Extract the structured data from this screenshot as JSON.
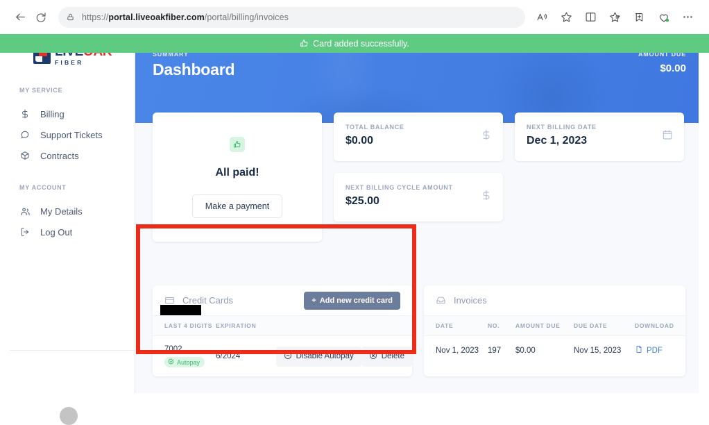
{
  "browser": {
    "url_bold": "portal.liveoakfiber.com",
    "url_rest": "/portal/billing/invoices",
    "url_scheme": "https://",
    "back_icon": "back-arrow-icon",
    "reload_icon": "reload-icon",
    "lock_icon": "lock-icon",
    "actions": [
      {
        "name": "read-aloud-icon",
        "label": "Read aloud"
      },
      {
        "name": "favorite-star-icon",
        "label": "Add to favorites"
      },
      {
        "name": "split-screen-icon",
        "label": "Split screen"
      },
      {
        "name": "collections-icon",
        "label": "Collections"
      },
      {
        "name": "add-to-collections-icon",
        "label": "Add to collections"
      },
      {
        "name": "browser-essentials-icon",
        "label": "Browser essentials"
      },
      {
        "name": "more-options-icon",
        "label": "Settings and more"
      }
    ]
  },
  "toast": {
    "message": "Card added successfully.",
    "icon": "thumbs-up-icon",
    "background": "#5fcb82"
  },
  "sidebar": {
    "logo": {
      "live": "LIVE",
      "oak": "OAK",
      "sub": "FIBER",
      "navy": "#1b3a6b",
      "red": "#e03127"
    },
    "groups": [
      {
        "label": "MY SERVICE",
        "items": [
          {
            "label": "Billing",
            "icon": "dollar-icon"
          },
          {
            "label": "Support Tickets",
            "icon": "chat-bubble-icon"
          },
          {
            "label": "Contracts",
            "icon": "box-icon"
          }
        ]
      },
      {
        "label": "MY ACCOUNT",
        "items": [
          {
            "label": "My Details",
            "icon": "users-icon"
          },
          {
            "label": "Log Out",
            "icon": "logout-icon"
          }
        ]
      }
    ]
  },
  "hero": {
    "eyebrow": "SUMMARY",
    "title": "Dashboard",
    "amount_due_label": "AMOUNT DUE",
    "amount_due_value": "$0.00",
    "background": "#4a86e8"
  },
  "paid_card": {
    "icon": "thumbs-up-icon",
    "title": "All paid!",
    "button_label": "Make a payment"
  },
  "stats": [
    {
      "label": "TOTAL BALANCE",
      "value": "$0.00",
      "icon": "dollar-icon"
    },
    {
      "label": "NEXT BILLING DATE",
      "value": "Dec 1, 2023",
      "icon": "calendar-icon"
    },
    {
      "label": "NEXT BILLING CYCLE AMOUNT",
      "value": "$25.00",
      "icon": "dollar-icon"
    }
  ],
  "credit_cards": {
    "title": "Credit Cards",
    "icon": "credit-card-icon",
    "add_button": "Add new credit card",
    "add_button_color": "#6c7c9b",
    "columns": [
      "LAST 4 DIGITS",
      "EXPIRATION",
      "",
      ""
    ],
    "rows": [
      {
        "last4": "7002",
        "autopay_badge": "Autopay",
        "expiration": "6/2024",
        "disable_label": "Disable Autopay",
        "delete_label": "Delete"
      }
    ]
  },
  "invoices": {
    "title": "Invoices",
    "icon": "inbox-icon",
    "columns": [
      "DATE",
      "NO.",
      "AMOUNT DUE",
      "DUE DATE",
      "DOWNLOAD"
    ],
    "rows": [
      {
        "date": "Nov 1, 2023",
        "no": "197",
        "amount_due": "$0.00",
        "due_date": "Nov 15, 2023",
        "download": "PDF"
      }
    ]
  },
  "annotation": {
    "color": "#ec2c18",
    "target": "credit-cards-panel"
  }
}
